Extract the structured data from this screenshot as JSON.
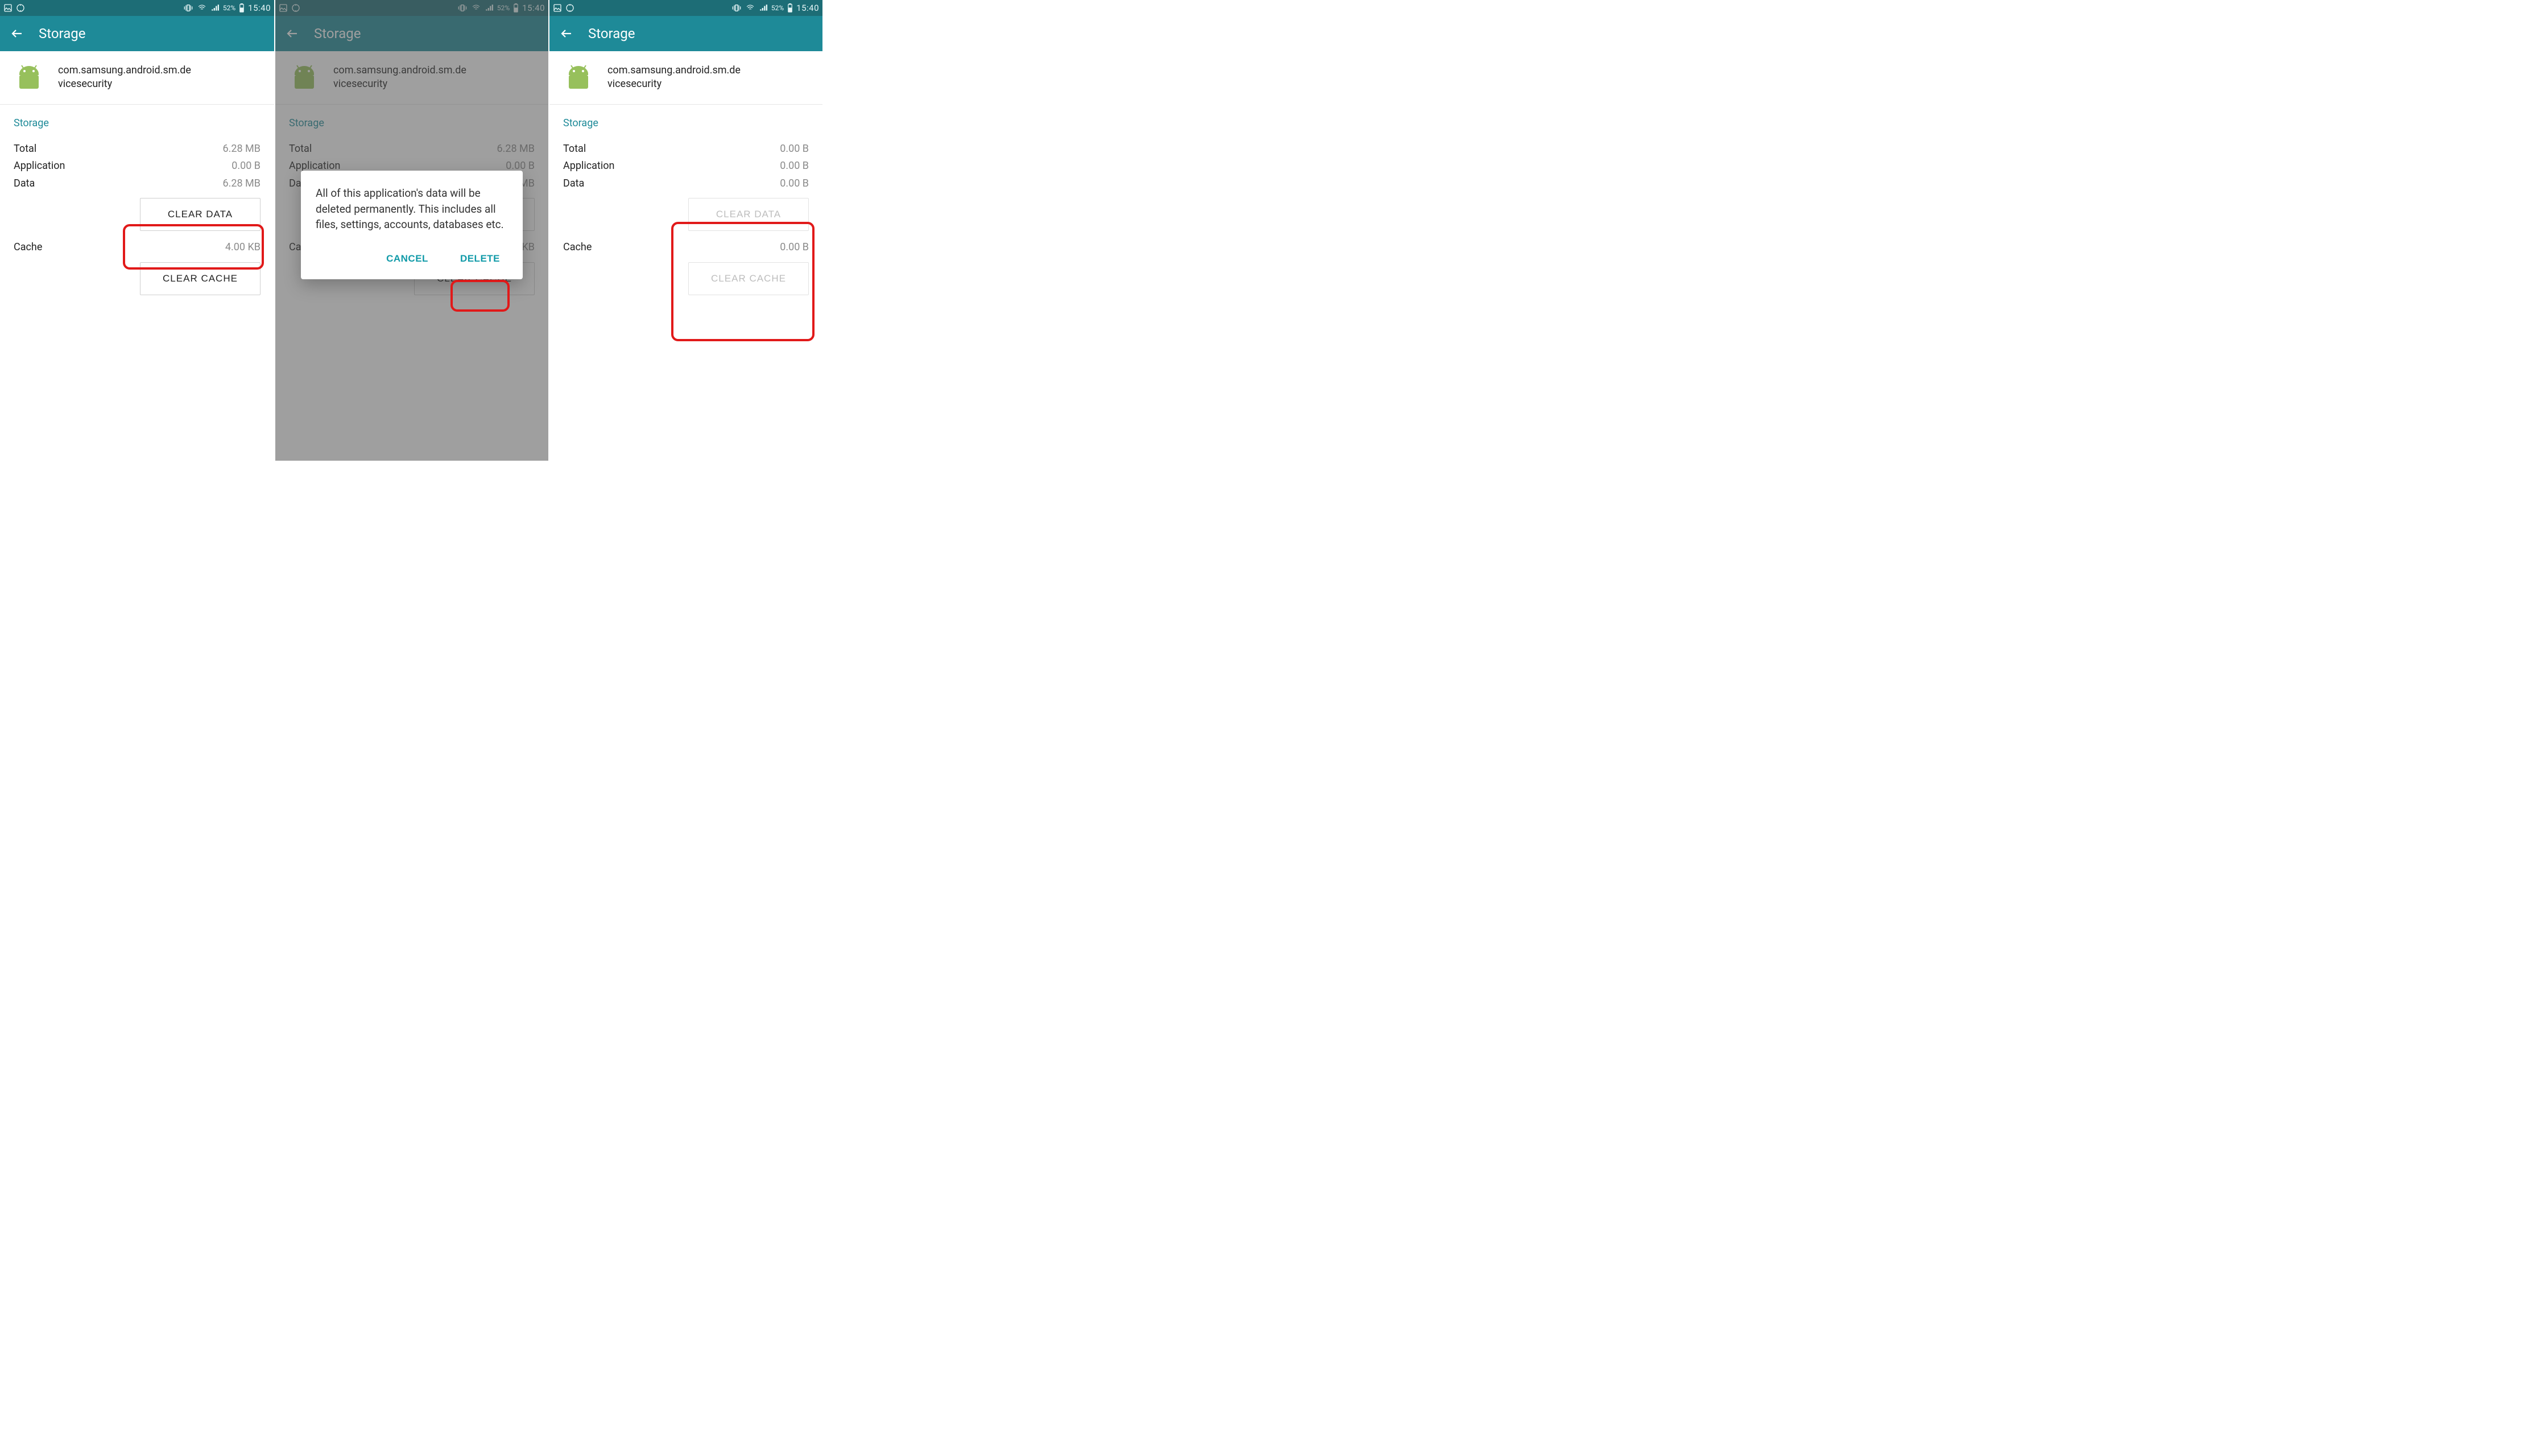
{
  "status": {
    "battery_pct": "52%",
    "time": "15:40"
  },
  "appbar": {
    "title": "Storage"
  },
  "app": {
    "package_line1": "com.samsung.android.sm.de",
    "package_line2": "vicesecurity"
  },
  "labels": {
    "section": "Storage",
    "total": "Total",
    "application": "Application",
    "data": "Data",
    "cache": "Cache",
    "clear_data": "CLEAR DATA",
    "clear_cache": "CLEAR CACHE"
  },
  "dialog": {
    "text": "All of this application's data will be deleted permanently. This includes all files, settings, accounts, databases etc.",
    "cancel": "CANCEL",
    "delete": "DELETE"
  },
  "screens": [
    {
      "total": "6.28 MB",
      "application": "0.00 B",
      "data": "6.28 MB",
      "cache": "4.00 KB",
      "buttons_disabled": false
    },
    {
      "total": "6.28 MB",
      "application": "0.00 B",
      "data": "6.28 MB",
      "cache": "4.00 KB",
      "buttons_disabled": false
    },
    {
      "total": "0.00 B",
      "application": "0.00 B",
      "data": "0.00 B",
      "cache": "0.00 B",
      "buttons_disabled": true
    }
  ]
}
